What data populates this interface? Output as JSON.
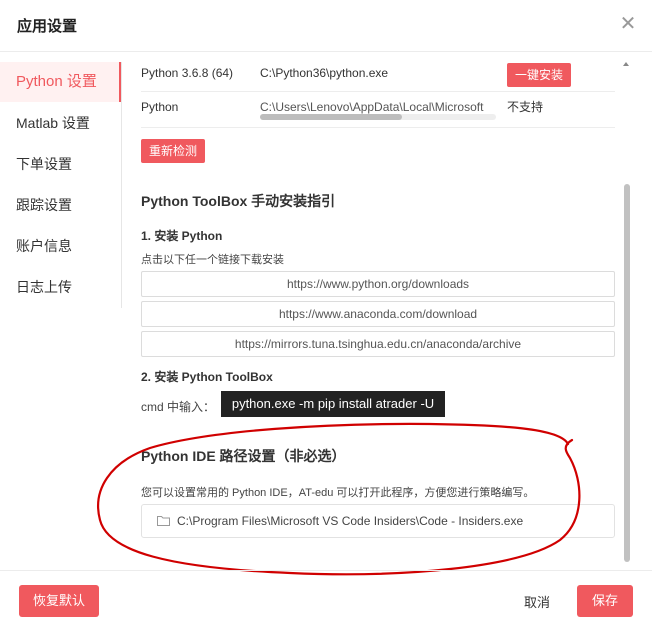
{
  "dialog": {
    "title": "应用设置"
  },
  "colors": {
    "accent": "#f0595e",
    "annotation": "#d00000"
  },
  "sidebar": {
    "items": [
      {
        "label": "Python 设置",
        "active": true
      },
      {
        "label": "Matlab 设置",
        "active": false
      },
      {
        "label": "下单设置",
        "active": false
      },
      {
        "label": "跟踪设置",
        "active": false
      },
      {
        "label": "账户信息",
        "active": false
      },
      {
        "label": "日志上传",
        "active": false
      }
    ]
  },
  "envs": [
    {
      "name": "Python 3.6.8 (64)",
      "path": "C:\\Python36\\python.exe",
      "action": "一键安装"
    },
    {
      "name": "Python",
      "path": "C:\\Users\\Lenovo\\AppData\\Local\\Microsoft",
      "action": "不支持",
      "path_scroll_fraction": 0.6
    }
  ],
  "redetect_label": "重新检测",
  "guide": {
    "title": "Python ToolBox 手动安装指引",
    "step1_title": "1. 安装 Python",
    "step1_desc": "点击以下任一个链接下载安装",
    "links": [
      "https://www.python.org/downloads",
      "https://www.anaconda.com/download",
      "https://mirrors.tuna.tsinghua.edu.cn/anaconda/archive"
    ],
    "step2_title": "2. 安装 Python ToolBox",
    "cmd_label": "cmd 中输入：",
    "cmd": "python.exe -m pip install atrader -U"
  },
  "ide": {
    "title": "Python IDE 路径设置（非必选）",
    "desc": "您可以设置常用的 Python IDE，AT-edu 可以打开此程序，方便您进行策略编写。",
    "path": "C:\\Program Files\\Microsoft VS Code Insiders\\Code - Insiders.exe",
    "folder_icon": "folder-icon"
  },
  "footer": {
    "reset": "恢复默认",
    "cancel": "取消",
    "save": "保存"
  }
}
